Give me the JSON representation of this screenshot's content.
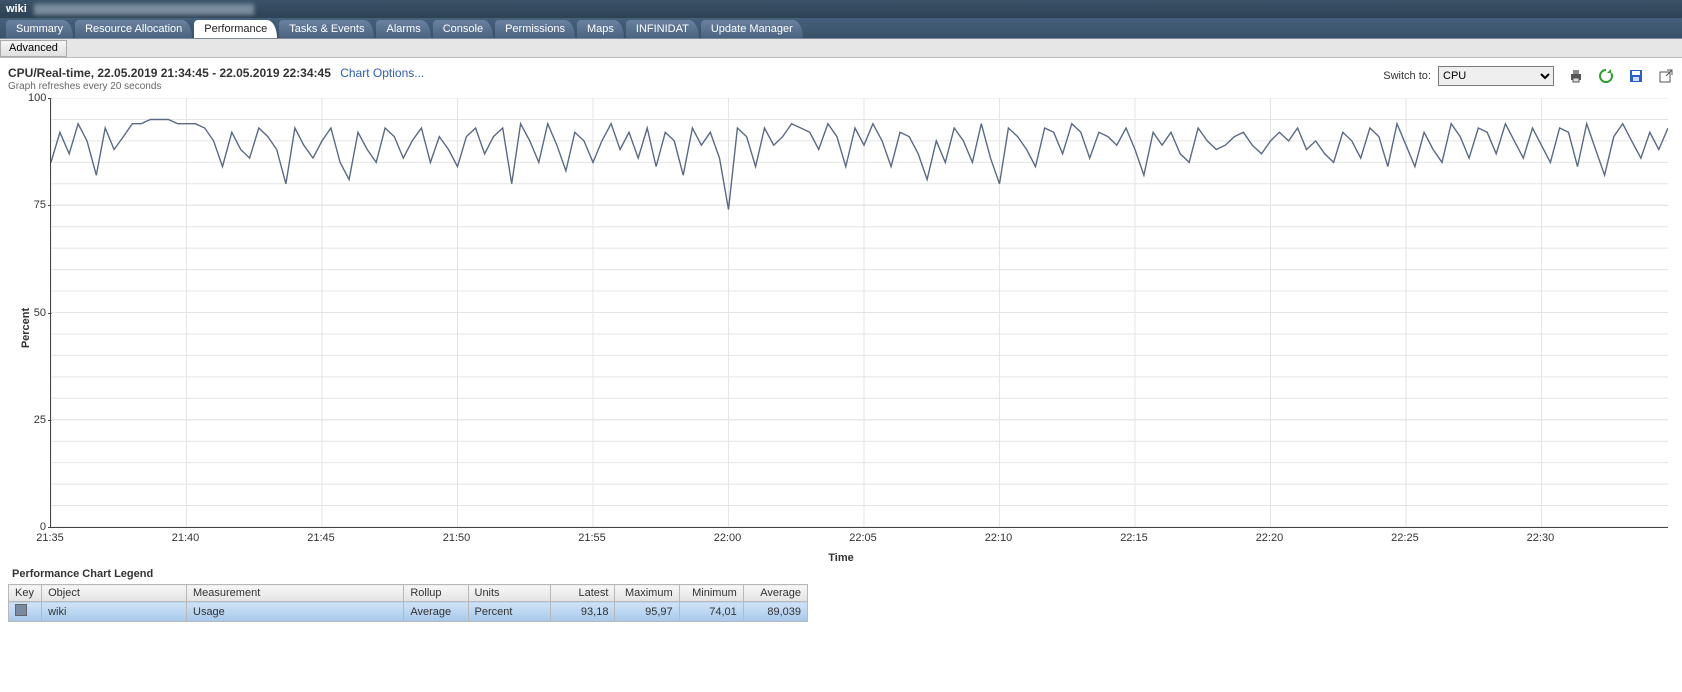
{
  "window": {
    "title_prefix": "wiki"
  },
  "tabs": [
    {
      "label": "Summary"
    },
    {
      "label": "Resource Allocation"
    },
    {
      "label": "Performance",
      "active": true
    },
    {
      "label": "Tasks & Events"
    },
    {
      "label": "Alarms"
    },
    {
      "label": "Console"
    },
    {
      "label": "Permissions"
    },
    {
      "label": "Maps"
    },
    {
      "label": "INFINIDAT"
    },
    {
      "label": "Update Manager"
    }
  ],
  "subtoolbar": {
    "advanced": "Advanced"
  },
  "header": {
    "title": "CPU/Real-time, 22.05.2019 21:34:45 - 22.05.2019 22:34:45",
    "chart_options": "Chart Options...",
    "refresh_note": "Graph refreshes every 20 seconds"
  },
  "toolbar_right": {
    "switch_label": "Switch to:",
    "switch_selected": "CPU"
  },
  "chart_data": {
    "type": "line",
    "title": "",
    "xlabel": "Time",
    "ylabel": "Percent",
    "ylim": [
      0,
      100
    ],
    "y_ticks": [
      0,
      25,
      50,
      75,
      100
    ],
    "x_tick_labels": [
      "21:35",
      "21:40",
      "21:45",
      "21:50",
      "21:55",
      "22:00",
      "22:05",
      "22:10",
      "22:15",
      "22:20",
      "22:25",
      "22:30"
    ],
    "categories_minutes": [
      35.0,
      35.33,
      35.67,
      36.0,
      36.33,
      36.67,
      37.0,
      37.33,
      37.67,
      38.0,
      38.33,
      38.67,
      39.0,
      39.33,
      39.67,
      40.0,
      40.33,
      40.67,
      41.0,
      41.33,
      41.67,
      42.0,
      42.33,
      42.67,
      43.0,
      43.33,
      43.67,
      44.0,
      44.33,
      44.67,
      45.0,
      45.33,
      45.67,
      46.0,
      46.33,
      46.67,
      47.0,
      47.33,
      47.67,
      48.0,
      48.33,
      48.67,
      49.0,
      49.33,
      49.67,
      50.0,
      50.33,
      50.67,
      51.0,
      51.33,
      51.67,
      52.0,
      52.33,
      52.67,
      53.0,
      53.33,
      53.67,
      54.0,
      54.33,
      54.67,
      55.0,
      55.33,
      55.67,
      56.0,
      56.33,
      56.67,
      57.0,
      57.33,
      57.67,
      58.0,
      58.33,
      58.67,
      59.0,
      59.33,
      59.67,
      60.0,
      60.33,
      60.67,
      61.0,
      61.33,
      61.67,
      62.0,
      62.33,
      62.67,
      63.0,
      63.33,
      63.67,
      64.0,
      64.33,
      64.67,
      65.0,
      65.33,
      65.67,
      66.0,
      66.33,
      66.67,
      67.0,
      67.33,
      67.67,
      68.0,
      68.33,
      68.67,
      69.0,
      69.33,
      69.67,
      70.0,
      70.33,
      70.67,
      71.0,
      71.33,
      71.67,
      72.0,
      72.33,
      72.67,
      73.0,
      73.33,
      73.67,
      74.0,
      74.33,
      74.67,
      75.0,
      75.33,
      75.67,
      76.0,
      76.33,
      76.67,
      77.0,
      77.33,
      77.67,
      78.0,
      78.33,
      78.67,
      79.0,
      79.33,
      79.67,
      80.0,
      80.33,
      80.67,
      81.0,
      81.33,
      81.67,
      82.0,
      82.33,
      82.67,
      83.0,
      83.33,
      83.67,
      84.0,
      84.33,
      84.67,
      85.0,
      85.33,
      85.67,
      86.0,
      86.33,
      86.67,
      87.0,
      87.33,
      87.67,
      88.0,
      88.33,
      88.67,
      89.0,
      89.33,
      89.67,
      90.0,
      90.33,
      90.67,
      91.0,
      91.33,
      91.67,
      92.0,
      92.33,
      92.67,
      93.0,
      93.33,
      93.67,
      94.0,
      94.33,
      94.67
    ],
    "series": [
      {
        "name": "Usage",
        "values": [
          85,
          92,
          87,
          94,
          90,
          82,
          93,
          88,
          91,
          94,
          94,
          95,
          95,
          95,
          94,
          94,
          94,
          93,
          90,
          84,
          92,
          88,
          86,
          93,
          91,
          88,
          80,
          93,
          89,
          86,
          90,
          93,
          85,
          81,
          92,
          88,
          85,
          93,
          91,
          86,
          90,
          93,
          85,
          91,
          88,
          84,
          91,
          93,
          87,
          91,
          93,
          80,
          94,
          90,
          85,
          94,
          89,
          83,
          92,
          90,
          85,
          90,
          94,
          88,
          92,
          86,
          93,
          84,
          92,
          90,
          82,
          93,
          89,
          92,
          86,
          74,
          93,
          91,
          84,
          93,
          89,
          91,
          94,
          93,
          92,
          88,
          94,
          91,
          84,
          93,
          89,
          94,
          90,
          84,
          92,
          91,
          87,
          81,
          90,
          85,
          93,
          90,
          85,
          94,
          86,
          80,
          93,
          91,
          88,
          84,
          93,
          92,
          87,
          94,
          92,
          86,
          92,
          91,
          89,
          93,
          88,
          82,
          92,
          89,
          92,
          87,
          85,
          93,
          90,
          88,
          89,
          91,
          92,
          89,
          87,
          90,
          92,
          90,
          93,
          88,
          90,
          87,
          85,
          92,
          90,
          86,
          93,
          91,
          84,
          94,
          89,
          84,
          92,
          88,
          85,
          94,
          91,
          86,
          93,
          92,
          87,
          94,
          90,
          86,
          93,
          89,
          85,
          93,
          92,
          84,
          94,
          88,
          82,
          91,
          94,
          90,
          86,
          92,
          88,
          93
        ]
      }
    ]
  },
  "legend": {
    "title": "Performance Chart Legend",
    "columns": [
      "Key",
      "Object",
      "Measurement",
      "Rollup",
      "Units",
      "Latest",
      "Maximum",
      "Minimum",
      "Average"
    ],
    "rows": [
      {
        "object": "wiki",
        "measurement": "Usage",
        "rollup": "Average",
        "units": "Percent",
        "latest": "93,18",
        "maximum": "95,97",
        "minimum": "74,01",
        "average": "89,039"
      }
    ]
  }
}
